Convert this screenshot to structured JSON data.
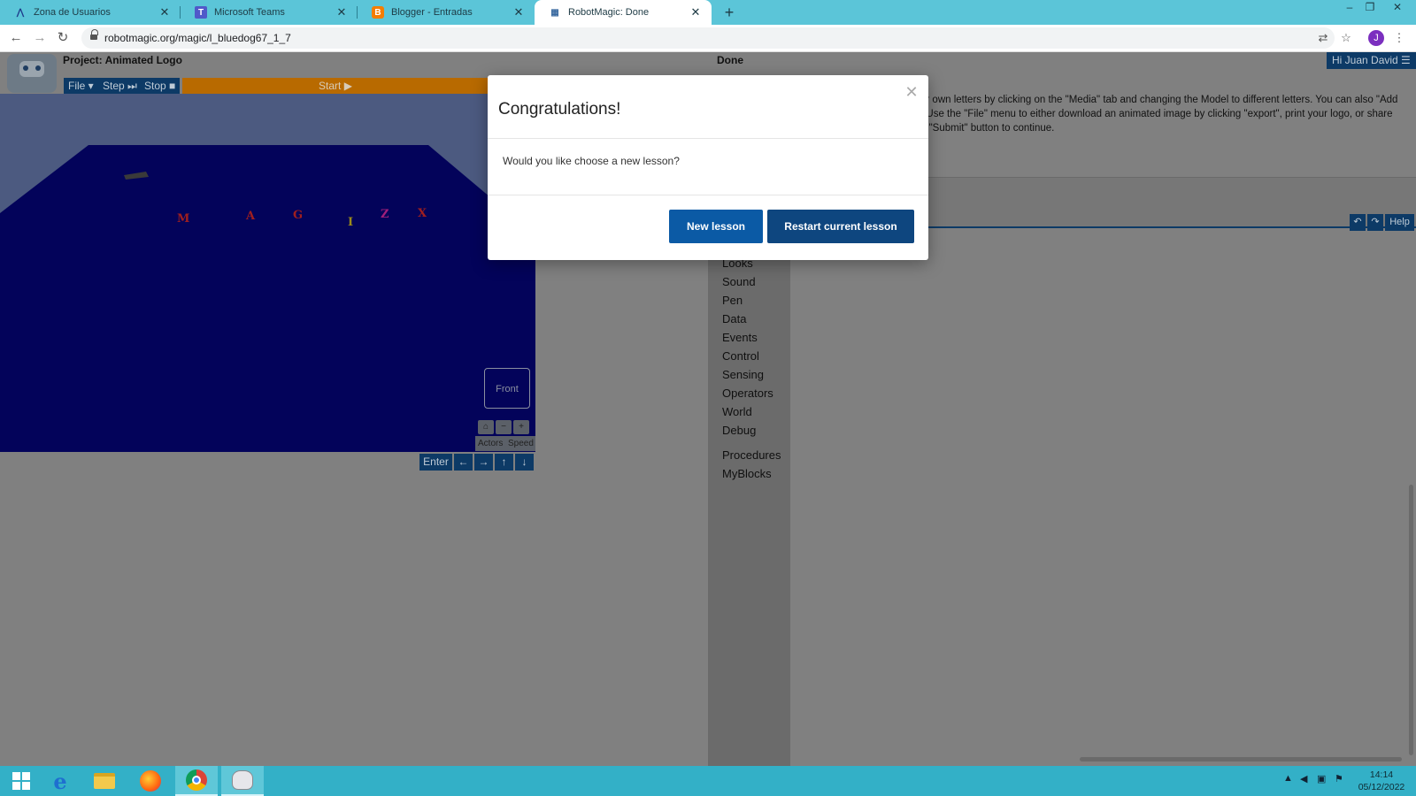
{
  "browser": {
    "tabs": [
      {
        "label": "Zona de Usuarios",
        "icon": "zona-usuarios-icon"
      },
      {
        "label": "Microsoft Teams",
        "icon": "teams-icon"
      },
      {
        "label": "Blogger - Entradas",
        "icon": "blogger-icon"
      },
      {
        "label": "RobotMagic: Done",
        "icon": "robotmagic-icon",
        "active": true
      }
    ],
    "url": "robotmagic.org/magic/l_bluedog67_1_7",
    "profile_initial": "J"
  },
  "stage": {
    "project_title": "Project: Animated Logo",
    "buttons": {
      "file": "File ▾",
      "step": "Step ⏭",
      "stop": "Stop ■"
    },
    "start_label": "Start ▶",
    "letters": [
      {
        "char": "M",
        "color": "#a01f1f"
      },
      {
        "char": "A",
        "color": "#a01f1f"
      },
      {
        "char": "G",
        "color": "#a01f1f"
      },
      {
        "char": "I",
        "color": "#9a8a1a"
      },
      {
        "char": "Z",
        "color": "#a01f7a"
      },
      {
        "char": "X",
        "color": "#a01f1f"
      }
    ],
    "viewcube_label": "Front",
    "actors_label": "Actors",
    "speed_label": "Speed",
    "enter_label": "Enter"
  },
  "instructions": {
    "title": "Done",
    "lines": [
      "ur own letters by clicking on the \"Media\" tab and changing the Model to different letters.  You can also \"Add",
      ".  Use the \"File\" menu to either download an animated image by clicking \"export\", print your logo, or share",
      "e \"Submit\" button to continue."
    ]
  },
  "user_menu": "Hi Juan David ☰",
  "help_label": "Help",
  "categories": [
    "Looks",
    "Sound",
    "Pen",
    "Data",
    "Events",
    "Control",
    "Sensing",
    "Operators",
    "World",
    "Debug",
    "Procedures",
    "MyBlocks"
  ],
  "modal": {
    "title": "Congratulations!",
    "body": "Would you like choose a new lesson?",
    "primary_button": "New lesson",
    "secondary_button": "Restart current lesson"
  },
  "taskbar": {
    "apps": [
      "windows-start-icon",
      "internet-explorer-icon",
      "file-explorer-icon",
      "firefox-icon",
      "chrome-icon",
      "scratch-app-icon"
    ],
    "time": "14:14",
    "date": "05/12/2022"
  },
  "colors": {
    "accent_dark_blue": "#0d3a66",
    "modal_primary": "#0b5aa5",
    "modal_secondary": "#0e467f",
    "tab_strip": "#5bc5d8",
    "taskbar": "#33b0c7",
    "start_bar": "#b86a00"
  }
}
